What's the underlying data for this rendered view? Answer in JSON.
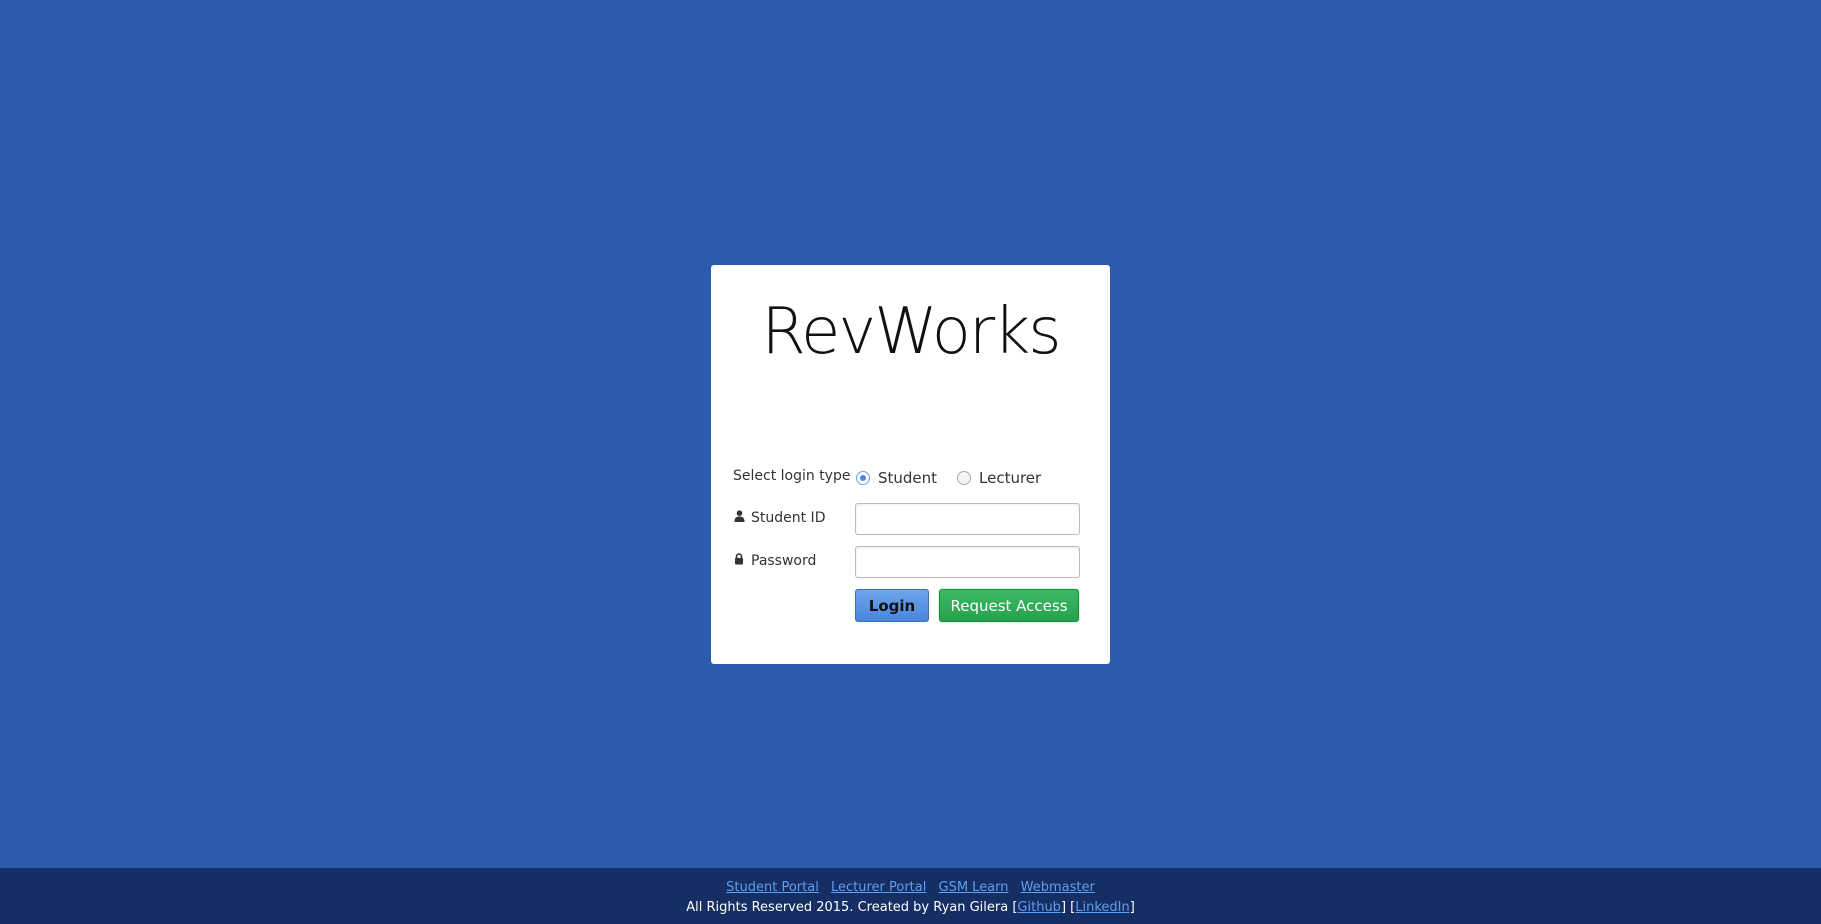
{
  "brand": {
    "title": "RevWorks"
  },
  "form": {
    "login_type_label": "Select login type",
    "login_types": [
      {
        "label": "Student",
        "selected": true
      },
      {
        "label": "Lecturer",
        "selected": false
      }
    ],
    "student_id": {
      "label": "Student ID",
      "value": "",
      "icon": "user-icon"
    },
    "password": {
      "label": "Password",
      "value": "",
      "icon": "lock-icon"
    },
    "login_button": "Login",
    "request_access_button": "Request Access"
  },
  "footer": {
    "links": [
      "Student Portal",
      "Lecturer Portal",
      "GSM Learn",
      "Webmaster"
    ],
    "credit_prefix": "All Rights Reserved 2015. Created by Ryan Gilera [",
    "github": "Github",
    "credit_mid": "] [",
    "linkedin": "LinkedIn",
    "credit_suffix": "]"
  },
  "colors": {
    "background": "#2d5bab",
    "footer": "#152e63",
    "login_button": "#4a86dc",
    "request_button": "#27a04c",
    "link": "#5f9ef0"
  }
}
